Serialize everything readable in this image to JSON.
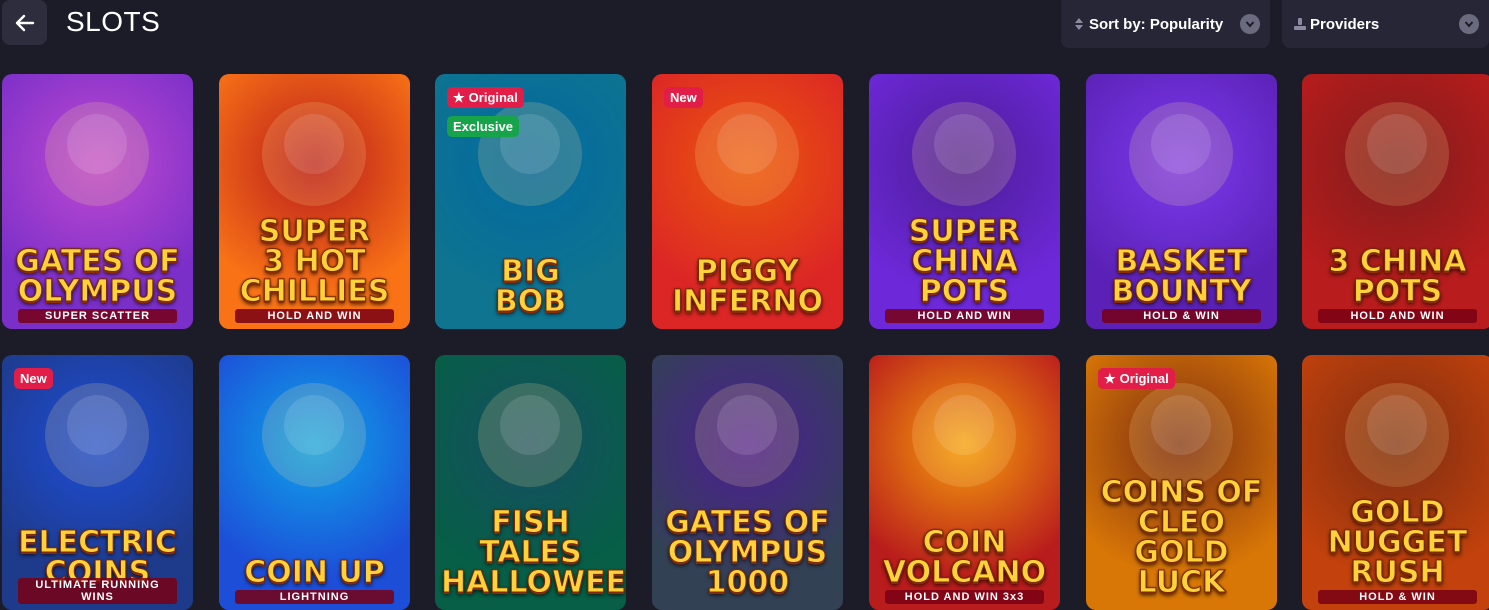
{
  "header": {
    "title": "SLOTS"
  },
  "sort": {
    "label": "Sort by: Popularity"
  },
  "providers": {
    "label": "Providers"
  },
  "games": [
    {
      "title": "Gates of\nOlympus",
      "subtitle": "SUPER SCATTER",
      "bg": [
        "#7b2fc9",
        "#c04ad1"
      ],
      "badges": []
    },
    {
      "title": "Super\n3 HOT\nChillies",
      "subtitle": "HOLD AND WIN",
      "bg": [
        "#f97316",
        "#b91c1c"
      ],
      "badges": []
    },
    {
      "title": "BIG\nBOB",
      "subtitle": "",
      "bg": [
        "#0e7490",
        "#0369a1"
      ],
      "badges": [
        {
          "text": "Original",
          "color": "red",
          "star": true
        },
        {
          "text": "Exclusive",
          "color": "green",
          "star": false
        }
      ]
    },
    {
      "title": "Piggy\nInferno",
      "subtitle": "",
      "bg": [
        "#dc2626",
        "#ea580c"
      ],
      "badges": [
        {
          "text": "New",
          "color": "red",
          "star": false
        }
      ]
    },
    {
      "title": "Super\nChina Pots",
      "subtitle": "HOLD AND WIN",
      "bg": [
        "#6d28d9",
        "#4c1d95"
      ],
      "badges": []
    },
    {
      "title": "Basket\nBounty",
      "subtitle": "HOLD & WIN",
      "bg": [
        "#5b21b6",
        "#7c3aed"
      ],
      "badges": []
    },
    {
      "title": "3 China\nPots",
      "subtitle": "HOLD AND WIN",
      "bg": [
        "#b91c1c",
        "#7f1d1d"
      ],
      "badges": []
    },
    {
      "title": "Electric\nCoins",
      "subtitle": "ULTIMATE RUNNING WINS",
      "bg": [
        "#1e3a8a",
        "#1d4ed8"
      ],
      "badges": [
        {
          "text": "New",
          "color": "red",
          "star": false
        }
      ]
    },
    {
      "title": "Coin Up",
      "subtitle": "LIGHTNING",
      "bg": [
        "#1d4ed8",
        "#0ea5e9"
      ],
      "badges": []
    },
    {
      "title": "Fish Tales\nHalloween",
      "subtitle": "",
      "bg": [
        "#065f46",
        "#164e63"
      ],
      "badges": []
    },
    {
      "title": "Gates of\nOlympus\n1000",
      "subtitle": "",
      "bg": [
        "#334155",
        "#4c1d95"
      ],
      "badges": []
    },
    {
      "title": "Coin\nVolcano",
      "subtitle": "HOLD AND WIN 3x3",
      "bg": [
        "#b91c1c",
        "#f59e0b"
      ],
      "badges": []
    },
    {
      "title": "Coins of\nCleo\nGold Luck",
      "subtitle": "",
      "bg": [
        "#d97706",
        "#7c2d12"
      ],
      "badges": [
        {
          "text": "Original",
          "color": "red",
          "star": true
        }
      ]
    },
    {
      "title": "Gold\nNugget\nRush",
      "subtitle": "HOLD & WIN",
      "bg": [
        "#c2410c",
        "#7c2d12"
      ],
      "badges": []
    }
  ]
}
